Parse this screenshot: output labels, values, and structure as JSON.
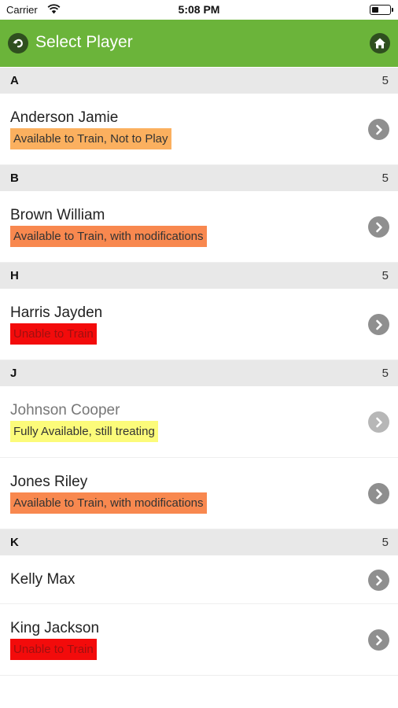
{
  "status_bar": {
    "carrier": "Carrier",
    "time": "5:08 PM"
  },
  "nav": {
    "title": "Select Player"
  },
  "colors": {
    "nav_green": "#6bb43a",
    "icon_dark": "#2f4f1f",
    "light_orange": "#fbb05f",
    "orange": "#f8884f",
    "red": "#f30b0b",
    "yellow": "#fcfb7a"
  },
  "sections": [
    {
      "letter": "A",
      "count": "5",
      "players": [
        {
          "name": "Anderson Jamie",
          "status": "Available to Train, Not to Play",
          "status_color": "#fbb05f"
        }
      ]
    },
    {
      "letter": "B",
      "count": "5",
      "players": [
        {
          "name": "Brown William",
          "status": "Available to Train, with modifications",
          "status_color": "#f8884f"
        }
      ]
    },
    {
      "letter": "H",
      "count": "5",
      "players": [
        {
          "name": "Harris Jayden",
          "status": "Unable to Train",
          "status_color": "#f30b0b"
        }
      ]
    },
    {
      "letter": "J",
      "count": "5",
      "players": [
        {
          "name": "Johnson Cooper",
          "status": "Fully Available, still treating",
          "status_color": "#fcfb7a"
        },
        {
          "name": "Jones Riley",
          "status": "Available to Train, with modifications",
          "status_color": "#f8884f"
        }
      ]
    },
    {
      "letter": "K",
      "count": "5",
      "players": [
        {
          "name": "Kelly Max",
          "status": "",
          "status_color": ""
        },
        {
          "name": "King Jackson",
          "status": "Unable to Train",
          "status_color": "#f30b0b"
        }
      ]
    }
  ],
  "icons": {
    "back": "back-arrow-icon",
    "home": "home-icon",
    "chevron": "chevron-right-icon",
    "wifi": "wifi-icon",
    "battery": "battery-icon"
  }
}
